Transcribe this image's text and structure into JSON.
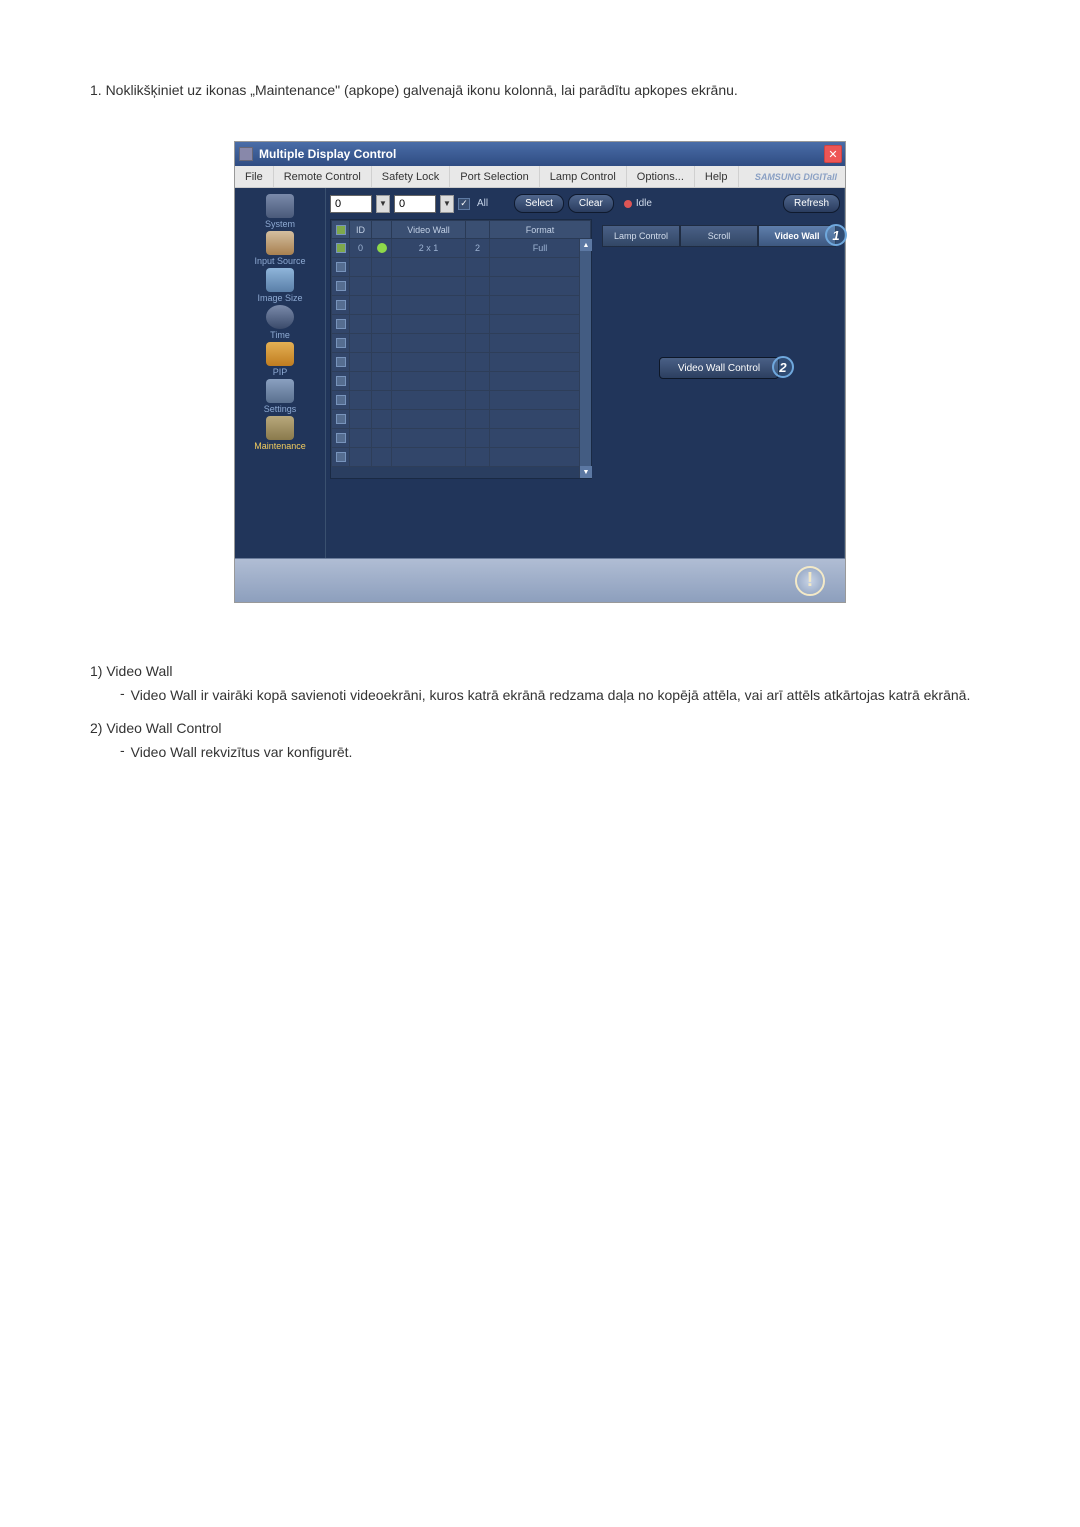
{
  "instruction": "1. Noklikšķiniet uz ikonas „Maintenance\" (apkope) galvenajā ikonu kolonnā, lai parādītu apkopes ekrānu.",
  "window": {
    "title": "Multiple Display Control",
    "brand": "SAMSUNG DIGITall"
  },
  "menu": {
    "file": "File",
    "remote_control": "Remote Control",
    "safety_lock": "Safety Lock",
    "port_selection": "Port Selection",
    "lamp_control": "Lamp Control",
    "options": "Options...",
    "help": "Help"
  },
  "sidebar": {
    "system": "System",
    "input_source": "Input Source",
    "image_size": "Image Size",
    "time": "Time",
    "pip": "PIP",
    "settings": "Settings",
    "maintenance": "Maintenance"
  },
  "toolbar": {
    "num1": "0",
    "num2": "0",
    "all": "All",
    "select": "Select",
    "clear": "Clear",
    "idle": "Idle",
    "refresh": "Refresh"
  },
  "table": {
    "headers": {
      "chk": "",
      "id": "ID",
      "status": "",
      "video_wall": "Video Wall",
      "div": "",
      "format": "Format"
    },
    "row": {
      "id": "0",
      "video_wall": "2 x 1",
      "div": "2",
      "format": "Full"
    }
  },
  "tabs": {
    "lamp_control": "Lamp Control",
    "scroll": "Scroll",
    "video_wall": "Video Wall"
  },
  "vw_control_btn": "Video Wall Control",
  "annot": {
    "one": "1",
    "two": "2"
  },
  "list": {
    "item1_title": "1)  Video Wall",
    "item1_desc": "Video Wall ir vairāki kopā savienoti videoekrāni, kuros katrā ekrānā redzama daļa no kopējā attēla, vai arī attēls atkārtojas katrā ekrānā.",
    "item2_title": "2)  Video Wall Control",
    "item2_desc": "Video Wall rekvizītus var konfigurēt."
  }
}
